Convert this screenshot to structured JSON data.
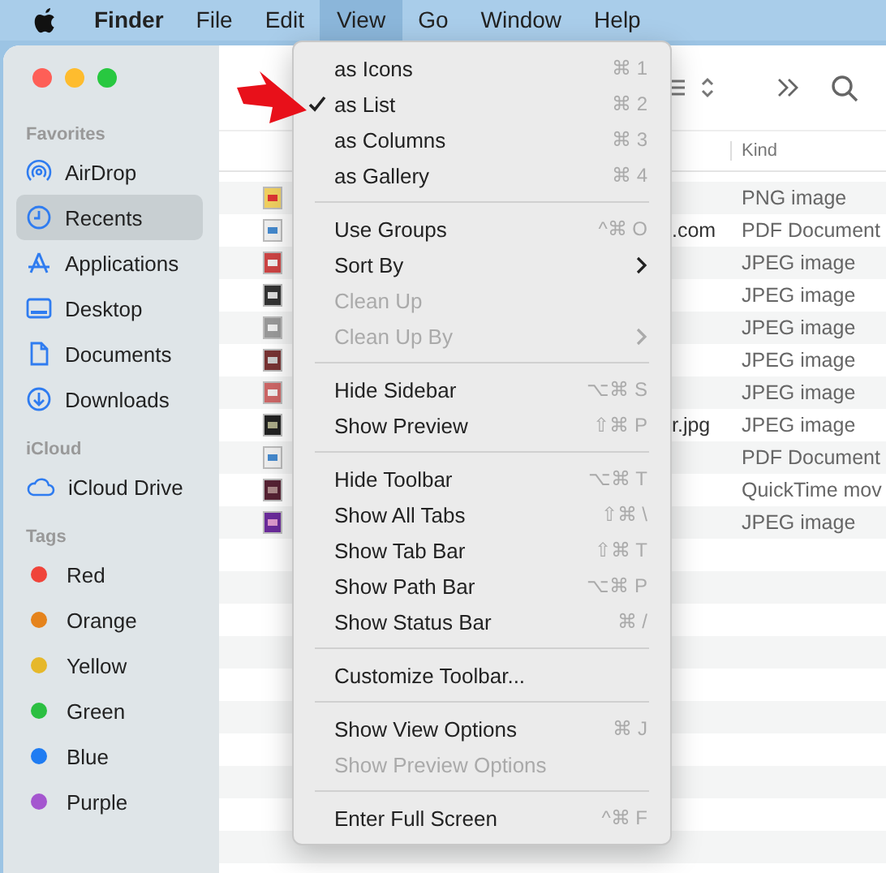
{
  "menubar": {
    "app": "Finder",
    "items": [
      {
        "label": "File",
        "selected": false
      },
      {
        "label": "Edit",
        "selected": false
      },
      {
        "label": "View",
        "selected": true
      },
      {
        "label": "Go",
        "selected": false
      },
      {
        "label": "Window",
        "selected": false
      },
      {
        "label": "Help",
        "selected": false
      }
    ]
  },
  "sidebar": {
    "sections": [
      {
        "header": "Favorites",
        "kind": "places",
        "items": [
          {
            "label": "AirDrop",
            "selected": false
          },
          {
            "label": "Recents",
            "selected": true
          },
          {
            "label": "Applications",
            "selected": false
          },
          {
            "label": "Desktop",
            "selected": false
          },
          {
            "label": "Documents",
            "selected": false
          },
          {
            "label": "Downloads",
            "selected": false
          }
        ]
      },
      {
        "header": "iCloud",
        "kind": "places",
        "items": [
          {
            "label": "iCloud Drive",
            "selected": false
          }
        ]
      },
      {
        "header": "Tags",
        "kind": "tags",
        "items": [
          {
            "label": "Red",
            "color": "#f0443a"
          },
          {
            "label": "Orange",
            "color": "#e5831c"
          },
          {
            "label": "Yellow",
            "color": "#e6b82a"
          },
          {
            "label": "Green",
            "color": "#2bbf41"
          },
          {
            "label": "Blue",
            "color": "#1f7cf2"
          },
          {
            "label": "Purple",
            "color": "#a456cf"
          }
        ]
      }
    ]
  },
  "file_list": {
    "columns": [
      {
        "label": "Kind"
      }
    ],
    "rows": [
      {
        "column_1": "",
        "kind": "PNG image"
      },
      {
        "column_1": ".com",
        "kind": "PDF Document"
      },
      {
        "column_1": "",
        "kind": "JPEG image"
      },
      {
        "column_1": "",
        "kind": "JPEG image"
      },
      {
        "column_1": "",
        "kind": "JPEG image"
      },
      {
        "column_1": "",
        "kind": "JPEG image"
      },
      {
        "column_1": "",
        "kind": "JPEG image"
      },
      {
        "column_1": "r.jpg",
        "kind": "JPEG image"
      },
      {
        "column_1": "",
        "kind": "PDF Document"
      },
      {
        "column_1": "",
        "kind": "QuickTime mov"
      },
      {
        "column_1": "",
        "kind": "JPEG image"
      }
    ]
  },
  "view_menu": {
    "items": [
      {
        "kind": "item",
        "label": "as Icons",
        "shortcut": "⌘ 1",
        "checked": false,
        "disabled": false,
        "submenu": false
      },
      {
        "kind": "item",
        "label": "as List",
        "shortcut": "⌘ 2",
        "checked": true,
        "disabled": false,
        "submenu": false
      },
      {
        "kind": "item",
        "label": "as Columns",
        "shortcut": "⌘ 3",
        "checked": false,
        "disabled": false,
        "submenu": false
      },
      {
        "kind": "item",
        "label": "as Gallery",
        "shortcut": "⌘ 4",
        "checked": false,
        "disabled": false,
        "submenu": false
      },
      {
        "kind": "separator"
      },
      {
        "kind": "item",
        "label": "Use Groups",
        "shortcut": "^⌘ O",
        "checked": false,
        "disabled": false,
        "submenu": false
      },
      {
        "kind": "item",
        "label": "Sort By",
        "checked": false,
        "disabled": false,
        "submenu": true
      },
      {
        "kind": "item",
        "label": "Clean Up",
        "checked": false,
        "disabled": true,
        "submenu": false
      },
      {
        "kind": "item",
        "label": "Clean Up By",
        "checked": false,
        "disabled": true,
        "submenu": true
      },
      {
        "kind": "separator"
      },
      {
        "kind": "item",
        "label": "Hide Sidebar",
        "shortcut": "⌥⌘ S",
        "checked": false,
        "disabled": false,
        "submenu": false
      },
      {
        "kind": "item",
        "label": "Show Preview",
        "shortcut": "⇧⌘ P",
        "checked": false,
        "disabled": false,
        "submenu": false
      },
      {
        "kind": "separator"
      },
      {
        "kind": "item",
        "label": "Hide Toolbar",
        "shortcut": "⌥⌘ T",
        "checked": false,
        "disabled": false,
        "submenu": false
      },
      {
        "kind": "item",
        "label": "Show All Tabs",
        "shortcut": "⇧⌘ \\",
        "checked": false,
        "disabled": false,
        "submenu": false
      },
      {
        "kind": "item",
        "label": "Show Tab Bar",
        "shortcut": "⇧⌘ T",
        "checked": false,
        "disabled": false,
        "submenu": false
      },
      {
        "kind": "item",
        "label": "Show Path Bar",
        "shortcut": "⌥⌘ P",
        "checked": false,
        "disabled": false,
        "submenu": false
      },
      {
        "kind": "item",
        "label": "Show Status Bar",
        "shortcut": "⌘ /",
        "checked": false,
        "disabled": false,
        "submenu": false
      },
      {
        "kind": "separator"
      },
      {
        "kind": "item",
        "label": "Customize Toolbar...",
        "checked": false,
        "disabled": false,
        "submenu": false
      },
      {
        "kind": "separator"
      },
      {
        "kind": "item",
        "label": "Show View Options",
        "shortcut": "⌘ J",
        "checked": false,
        "disabled": false,
        "submenu": false
      },
      {
        "kind": "item",
        "label": "Show Preview Options",
        "checked": false,
        "disabled": true,
        "submenu": false
      },
      {
        "kind": "separator"
      },
      {
        "kind": "item",
        "label": "Enter Full Screen",
        "shortcut": "^⌘ F",
        "checked": false,
        "disabled": false,
        "submenu": false
      }
    ]
  }
}
